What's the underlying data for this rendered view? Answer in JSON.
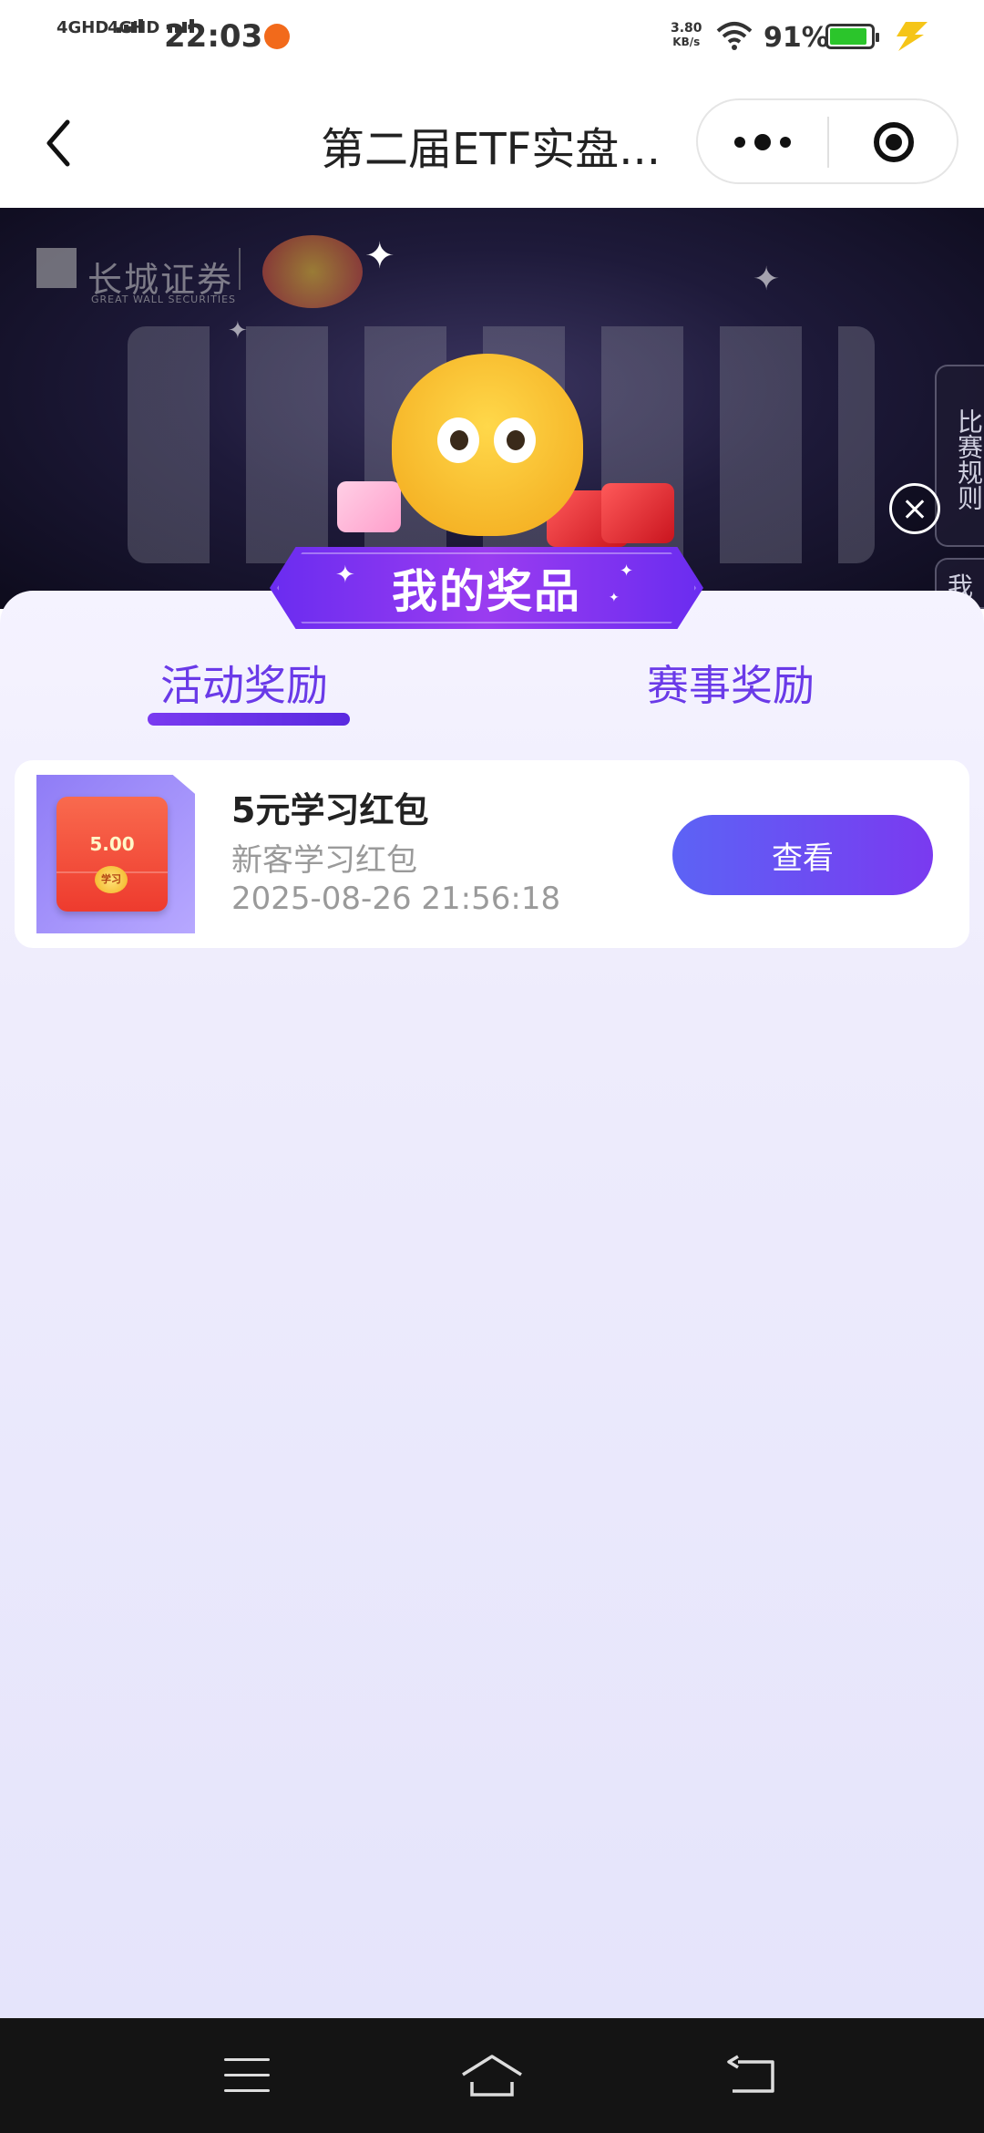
{
  "status_bar": {
    "signal1": "4GHD",
    "signal2": "4GHD",
    "time": "22:03",
    "net_speed_value": "3.80",
    "net_speed_unit": "KB/s",
    "battery_percent": "91%",
    "icons": [
      "signal-icon",
      "signal-icon",
      "notification-app-icon",
      "wifi-icon",
      "battery-icon",
      "charging-icon"
    ]
  },
  "title_bar": {
    "title": "第二届ETF实盘...",
    "icons": [
      "back-arrow-icon",
      "more-dots-icon",
      "target-circle-icon"
    ]
  },
  "banner": {
    "brand_name": "长城证券",
    "brand_sub": "GREAT WALL SECURITIES",
    "side_rules_label": "比赛规则",
    "side_second_label": "我"
  },
  "panel": {
    "header": "我的奖品",
    "tabs": [
      {
        "label": "活动奖励",
        "active": true
      },
      {
        "label": "赛事奖励",
        "active": false
      }
    ],
    "rewards": [
      {
        "title": "5元学习红包",
        "subtitle": "新客学习红包",
        "time": "2025-08-26 21:56:18",
        "thumb_amount": "5.00",
        "thumb_seal": "学习",
        "action_label": "查看"
      }
    ]
  },
  "colors": {
    "accent_purple": "#6a3ae8",
    "button_gradient_start": "#5c63f5",
    "button_gradient_end": "#7a3af0",
    "panel_bg": "#eeecfc",
    "nav_bar_bg": "#141414"
  }
}
